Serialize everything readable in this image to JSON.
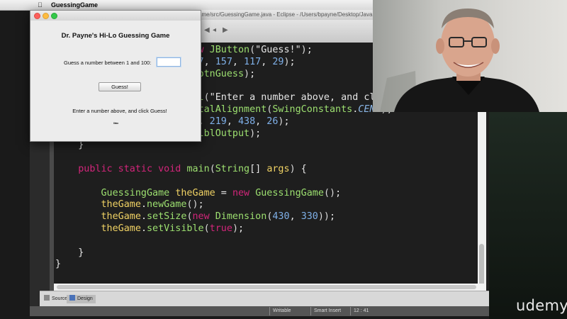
{
  "menubar": {
    "app_name": "GuessingGame"
  },
  "eclipse": {
    "title": "ame/src/GuessingGame.java - Eclipse - /Users/bpayne/Desktop/Java",
    "bottom_tabs": [
      {
        "label": "Source"
      },
      {
        "label": "Design"
      }
    ],
    "status": {
      "mode": "Writable",
      "insert": "Smart Insert",
      "position": "12 : 41"
    }
  },
  "swing": {
    "heading": "Dr. Payne's Hi-Lo Guessing Game",
    "prompt": "Guess a number between 1 and 100:",
    "input_value": "",
    "button_label": "Guess!",
    "output": "Enter a number above, and click Guess!"
  },
  "brand": {
    "watermark": "udemy"
  }
}
